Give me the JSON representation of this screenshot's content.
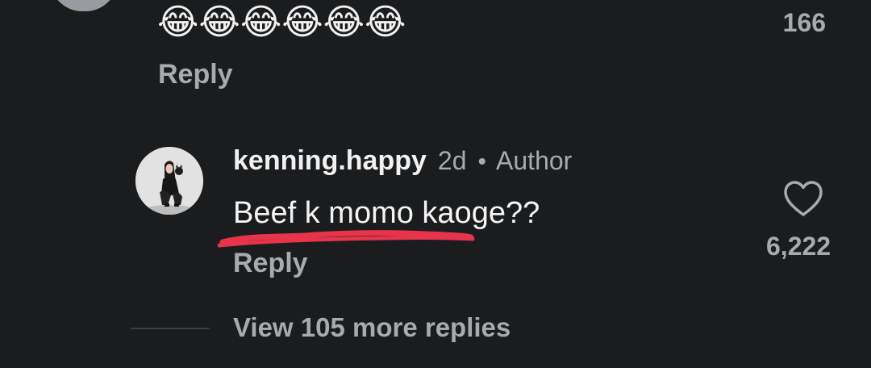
{
  "previous_comment": {
    "emojis": "😂😂😂😂😂😂",
    "like_count": "166",
    "reply_label": "Reply"
  },
  "comment": {
    "username": "kenning.happy",
    "timestamp": "2d",
    "separator": "•",
    "badge": "Author",
    "text": "Beef k momo kaoge??",
    "reply_label": "Reply",
    "like_count": "6,222",
    "like_icon": "heart-outline-icon",
    "annotation_color": "#e8344a"
  },
  "view_more_replies": "View 105 more replies",
  "colors": {
    "background": "#1b1c1e",
    "primary_text": "#f1f1f1",
    "secondary_text": "#a9aaae"
  }
}
